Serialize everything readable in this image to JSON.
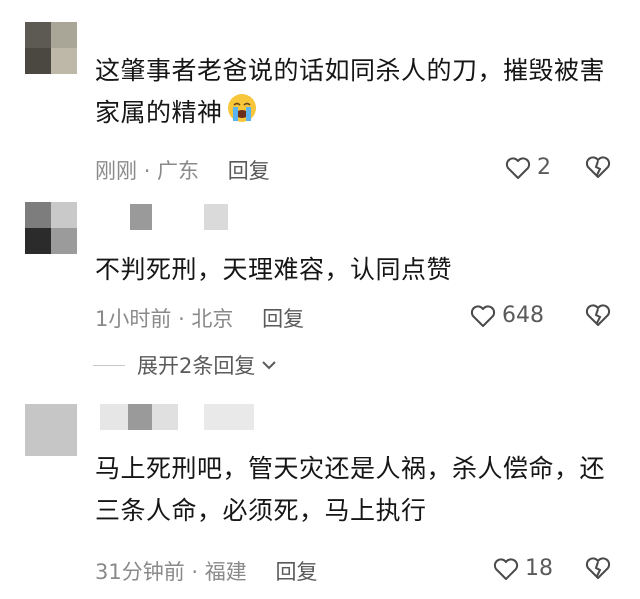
{
  "comments": [
    {
      "text": "这肇事者老爸说的话如同杀人的刀，摧毁被害家属的精神",
      "emoji": "loudly-crying-face",
      "time": "刚刚",
      "location": "广东",
      "reply": "回复",
      "likes": "2"
    },
    {
      "text": "不判死刑，天理难容，认同点赞",
      "time": "1小时前",
      "location": "北京",
      "reply": "回复",
      "likes": "648",
      "expand": "展开2条回复"
    },
    {
      "text": "马上死刑吧，管天灾还是人祸，杀人偿命，还三条人命，必须死，马上执行",
      "time": "31分钟前",
      "location": "福建",
      "reply": "回复",
      "likes": "18"
    }
  ],
  "separator": "·",
  "colors": {
    "meta": "#8a8a8a",
    "text": "#161616",
    "icon": "#5a5a5a"
  }
}
